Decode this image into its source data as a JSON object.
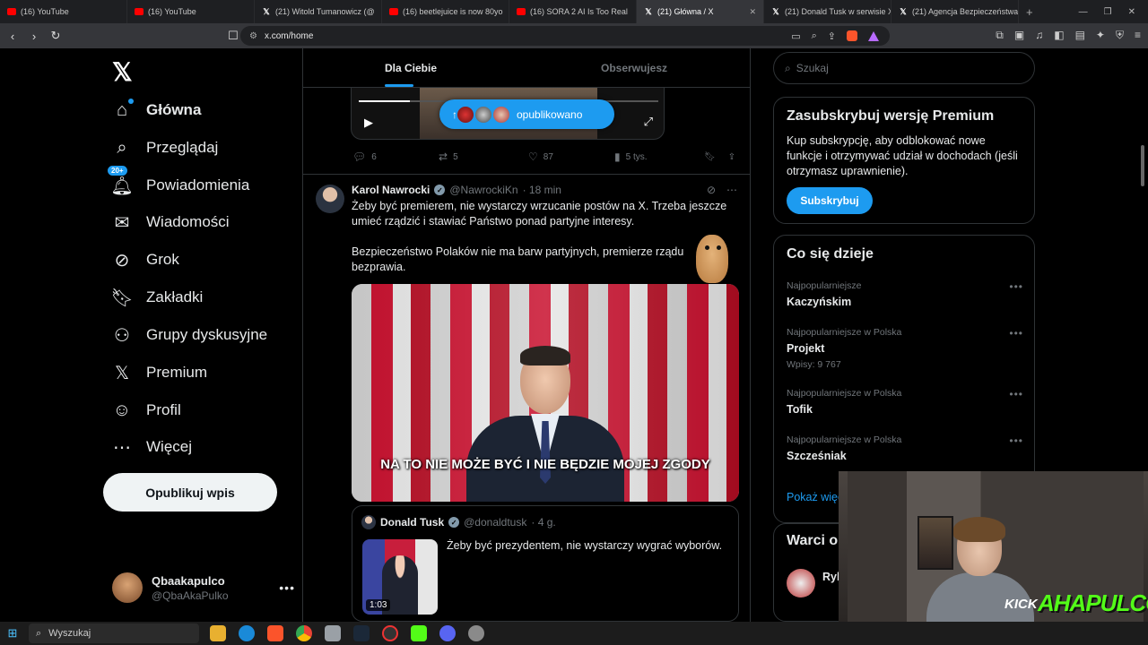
{
  "browser": {
    "tabs": [
      {
        "title": "(16) YouTube",
        "icon": "youtube-icon"
      },
      {
        "title": "(16) YouTube",
        "icon": "youtube-icon"
      },
      {
        "title": "(21) Witold Tumanowicz (@",
        "icon": "x-icon"
      },
      {
        "title": "(16) beetlejuice is now 80yo",
        "icon": "youtube-icon"
      },
      {
        "title": "(16) SORA 2 AI Is Too Real",
        "icon": "youtube-icon"
      },
      {
        "title": "(21) Główna / X",
        "icon": "x-icon",
        "active": true
      },
      {
        "title": "(21) Donald Tusk w serwisie X",
        "icon": "x-icon"
      },
      {
        "title": "(21) Agencja Bezpieczeństwa N",
        "icon": "x-icon"
      }
    ],
    "url": "x.com/home"
  },
  "sidebar": {
    "items": [
      {
        "label": "Główna",
        "icon": "home-icon"
      },
      {
        "label": "Przeglądaj",
        "icon": "search-icon"
      },
      {
        "label": "Powiadomienia",
        "icon": "bell-icon",
        "badge": "20+"
      },
      {
        "label": "Wiadomości",
        "icon": "mail-icon"
      },
      {
        "label": "Grok",
        "icon": "grok-icon"
      },
      {
        "label": "Zakładki",
        "icon": "bookmark-icon"
      },
      {
        "label": "Grupy dyskusyjne",
        "icon": "communities-icon"
      },
      {
        "label": "Premium",
        "icon": "x-premium-icon"
      },
      {
        "label": "Profil",
        "icon": "profile-icon"
      },
      {
        "label": "Więcej",
        "icon": "more-circle-icon"
      }
    ],
    "post_button": "Opublikuj wpis",
    "account": {
      "name": "Qbaakapulco",
      "handle": "@QbaAkaPulko"
    }
  },
  "timeline": {
    "tabs": [
      "Dla Ciebie",
      "Obserwujesz"
    ],
    "new_posts_pill": "opublikowano",
    "prev_post_actions": {
      "replies": "6",
      "reposts": "5",
      "likes": "87",
      "views": "5 tys."
    },
    "tweet": {
      "name": "Karol Nawrocki",
      "handle": "@NawrockiKn",
      "time": "· 18 min",
      "text1": "Żeby być premierem, nie wystarczy wrzucanie postów na X. Trzeba jeszcze umieć rządzić i stawiać Państwo ponad partyjne interesy.",
      "text2": "Bezpieczeństwo Polaków nie ma barw partyjnych, premierze rządu bezprawia.",
      "video_subtitle": "NA TO NIE MOŻE BYĆ I NIE BĘDZIE MOJEJ ZGODY",
      "quote": {
        "name": "Donald Tusk",
        "handle": "@donaldtusk",
        "time": "· 4 g.",
        "text": "Żeby być prezydentem, nie wystarczy wygrać wyborów.",
        "duration": "1:03"
      }
    }
  },
  "right": {
    "search_placeholder": "Szukaj",
    "premium": {
      "title": "Zasubskrybuj wersję Premium",
      "text": "Kup subskrypcję, aby odblokować nowe funkcje i otrzymywać udział w dochodach (jeśli otrzymasz uprawnienie).",
      "button": "Subskrybuj"
    },
    "trends": {
      "title": "Co się dzieje",
      "items": [
        {
          "meta": "Najpopularniejsze",
          "topic": "Kaczyńskim"
        },
        {
          "meta": "Najpopularniejsze w Polska",
          "topic": "Projekt",
          "count": "Wpisy: 9 767"
        },
        {
          "meta": "Najpopularniejsze w Polska",
          "topic": "Tofik"
        },
        {
          "meta": "Najpopularniejsze w Polska",
          "topic": "Szcześniak"
        }
      ],
      "show_more": "Pokaż więcej"
    },
    "follow": {
      "title": "Warci obserwowania",
      "rec_name": "Ryb"
    }
  },
  "overlay": {
    "platform": "KICK",
    "brand": "AHAPULCO"
  },
  "taskbar": {
    "search": "Wyszukaj"
  },
  "colors": {
    "accent": "#1d9bf0",
    "background": "#000000",
    "kick_green": "#53fc18"
  }
}
